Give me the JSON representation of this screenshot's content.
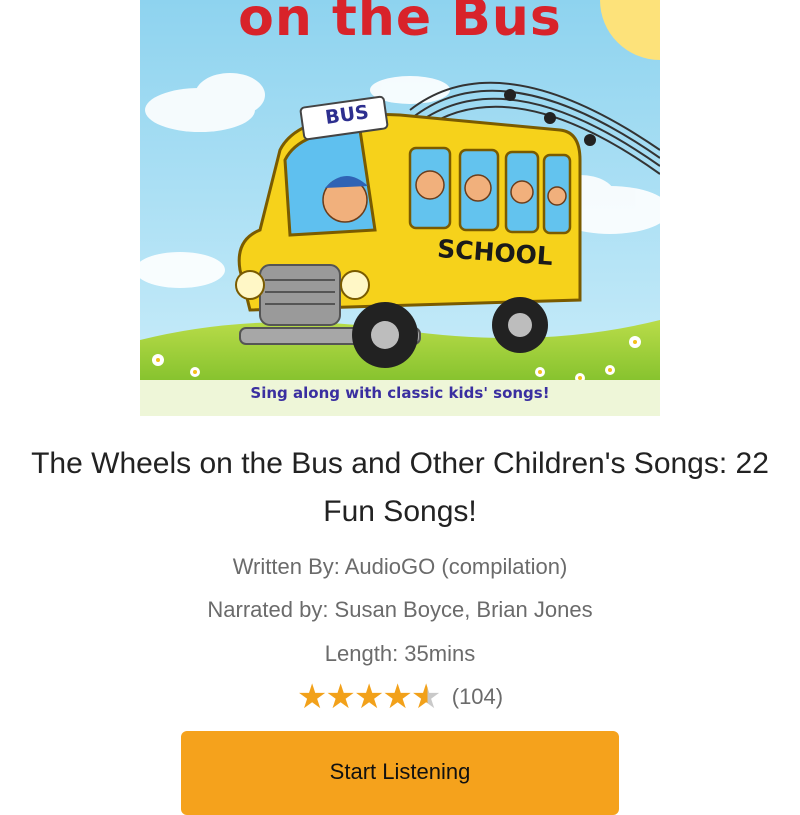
{
  "cover": {
    "title_fragment": "on the Bus",
    "bus_sign": "BUS",
    "school_sign": "SCHOOL",
    "tagline": "Sing along with classic kids' songs!"
  },
  "book": {
    "title": "The Wheels on the Bus and Other Children's Songs: 22 Fun Songs!",
    "written_by": "Written By: AudioGO (compilation)",
    "narrated_by": "Narrated by: Susan Boyce, Brian Jones",
    "length": "Length: 35mins",
    "rating_value": 4.5,
    "rating_max": 5,
    "rating_count": "(104)"
  },
  "actions": {
    "start_label": "Start Listening"
  },
  "colors": {
    "accent": "#f5a21c",
    "star": "#f2a11a",
    "cover_title": "#d8232a"
  }
}
